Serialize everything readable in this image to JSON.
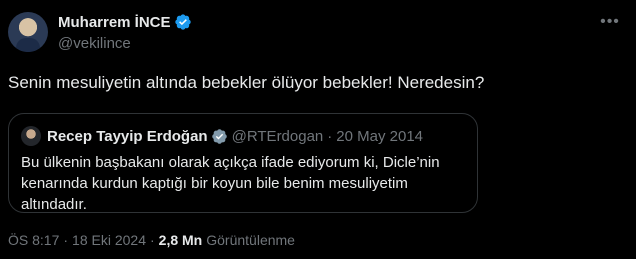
{
  "author": {
    "display_name": "Muharrem İNCE",
    "handle": "@vekilince"
  },
  "tweet": {
    "text": "Senin mesuliyetin altında bebekler ölüyor bebekler! Neredesin?"
  },
  "quote": {
    "display_name": "Recep Tayyip Erdoğan",
    "handle": "@RTErdogan",
    "separator": "·",
    "date": "20 May 2014",
    "text": "Bu ülkenin başbakanı olarak açıkça ifade ediyorum ki, Dicle’nin kenarında kurdun kaptığı bir koyun bile benim mesuliyetim altındadır."
  },
  "meta": {
    "time": "ÖS 8:17",
    "dot1": "·",
    "date": "18 Eki 2024",
    "dot2": "·",
    "views_count": "2,8 Mn",
    "views_label": "Görüntülenme"
  },
  "icons": {
    "verified": "verified-badge-icon",
    "more": "more-options-icon"
  },
  "colors": {
    "background": "#000000",
    "text": "#e7e9ea",
    "secondary_text": "#71767b",
    "verified_blue": "#1d9bf0",
    "border": "#2f3336"
  }
}
